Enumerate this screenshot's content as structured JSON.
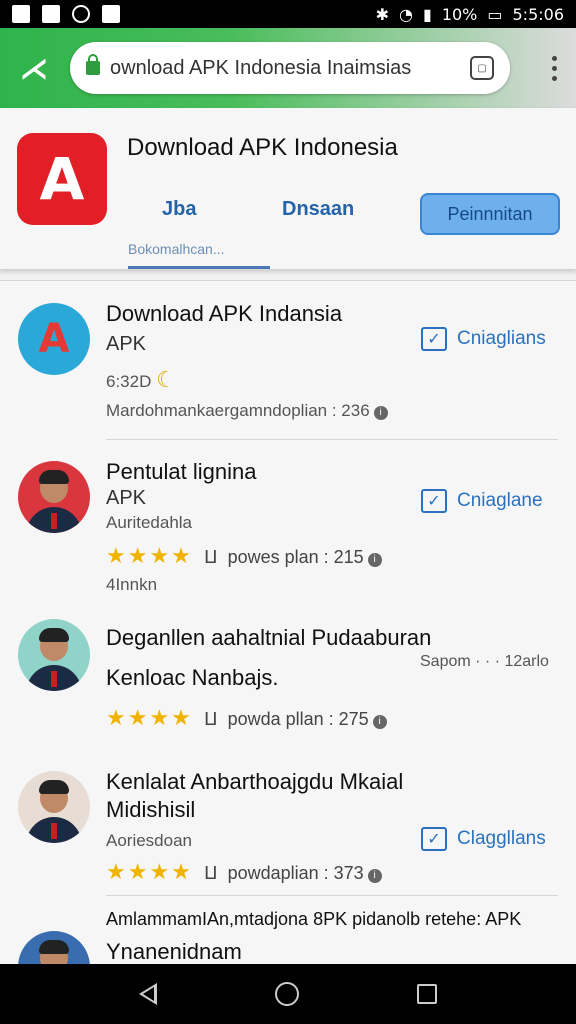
{
  "status_bar": {
    "battery": "10%",
    "time": "5:5:06"
  },
  "browser": {
    "url": "ownload APK Indonesia  Inaimsias",
    "tab_icon": "tab-icon"
  },
  "header": {
    "title": "Download APK Indonesia",
    "tabs": [
      {
        "label": "Jba",
        "sub": "Bokomalhcan..."
      },
      {
        "label": "Dnsaan"
      }
    ],
    "button_label": "Peinnnitan"
  },
  "list": [
    {
      "title": "Download APK Indansia",
      "subtitle": "APK",
      "detail": "6:32D",
      "meta": "Mardohmankaergamndoplian : 236",
      "action_label": "Cniaglians"
    },
    {
      "title": "Pentulat lignina",
      "subtitle": "APK",
      "detail": "Auritedahla",
      "stars": "★★★★",
      "rating_text": "powes plan : 215",
      "extra": "4Innkn",
      "action_label": "Cniaglane"
    },
    {
      "title": "Deganllen aahaltnial Pudaaburan",
      "subtitle": "Kenloac Nanbajs.",
      "meta_right": "Sapom · · · 12arlo",
      "stars": "★★★★",
      "rating_text": "powda pllan : 275"
    },
    {
      "title": "Kenlalat Anbarthoajgdu Mkaial",
      "title_line2": "Midishisil",
      "detail": "Aoriesdoan",
      "stars": "★★★★",
      "rating_text": "powdaplian : 373",
      "action_label": "Claggllans"
    },
    {
      "title": "AmlammamIAn,mtadjona 8PK pidanolb retehe: APK",
      "title_line2": "Ynanenidnam"
    }
  ],
  "colors": {
    "browser_green": "#2fb34a",
    "accent_blue": "#2a72bf",
    "star": "#f0b400",
    "app_red": "#e21f26"
  }
}
